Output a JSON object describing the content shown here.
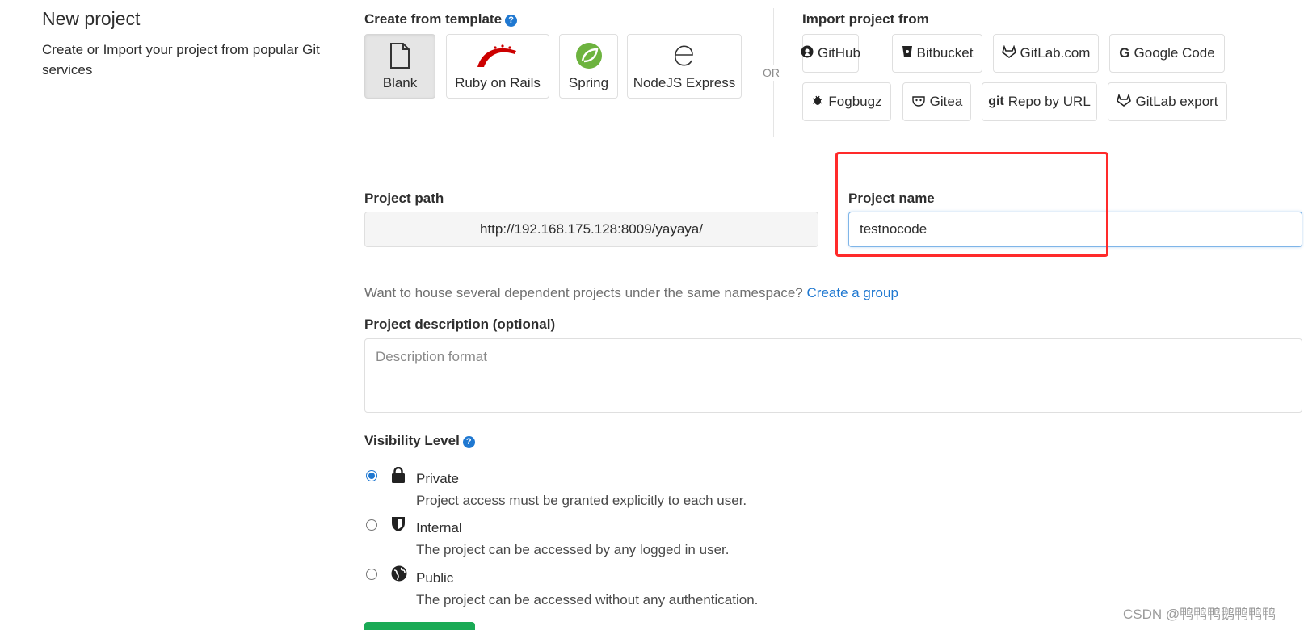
{
  "page": {
    "title": "New project",
    "subtitle": "Create or Import your project from popular Git services"
  },
  "templates": {
    "heading": "Create from template",
    "items": [
      {
        "label": "Blank",
        "icon": "blank-file-icon",
        "active": true
      },
      {
        "label": "Ruby on Rails",
        "icon": "rails-icon"
      },
      {
        "label": "Spring",
        "icon": "spring-icon"
      },
      {
        "label": "NodeJS Express",
        "icon": "express-icon"
      }
    ]
  },
  "or_label": "OR",
  "import": {
    "heading": "Import project from",
    "items": [
      {
        "label": "GitHub",
        "icon": "github-icon"
      },
      {
        "label": "Bitbucket",
        "icon": "bitbucket-icon"
      },
      {
        "label": "GitLab.com",
        "icon": "gitlab-icon"
      },
      {
        "label": "Google Code",
        "icon": "google-icon"
      },
      {
        "label": "Fogbugz",
        "icon": "bug-icon"
      },
      {
        "label": "Gitea",
        "icon": "gitea-icon"
      },
      {
        "label": "Repo by URL",
        "icon": "git-icon"
      },
      {
        "label": "GitLab export",
        "icon": "gitlab-icon"
      }
    ]
  },
  "form": {
    "project_path_label": "Project path",
    "project_path_value": "http://192.168.175.128:8009/yayaya/",
    "project_name_label": "Project name",
    "project_name_value": "testnocode",
    "namespace_hint": "Want to house several dependent projects under the same namespace?",
    "create_group_link": "Create a group",
    "description_label": "Project description (optional)",
    "description_placeholder": "Description format",
    "visibility_label": "Visibility Level",
    "visibility_options": [
      {
        "label": "Private",
        "description": "Project access must be granted explicitly to each user.",
        "icon": "lock-icon",
        "checked": true
      },
      {
        "label": "Internal",
        "description": "The project can be accessed by any logged in user.",
        "icon": "shield-icon",
        "checked": false
      },
      {
        "label": "Public",
        "description": "The project can be accessed without any authentication.",
        "icon": "globe-icon",
        "checked": false
      }
    ]
  },
  "watermark": "CSDN @鸭鸭鸭鹅鸭鸭鸭",
  "colors": {
    "accent": "#1f78d1",
    "highlight": "#ff2a2a",
    "create_button": "#1aaa55"
  }
}
